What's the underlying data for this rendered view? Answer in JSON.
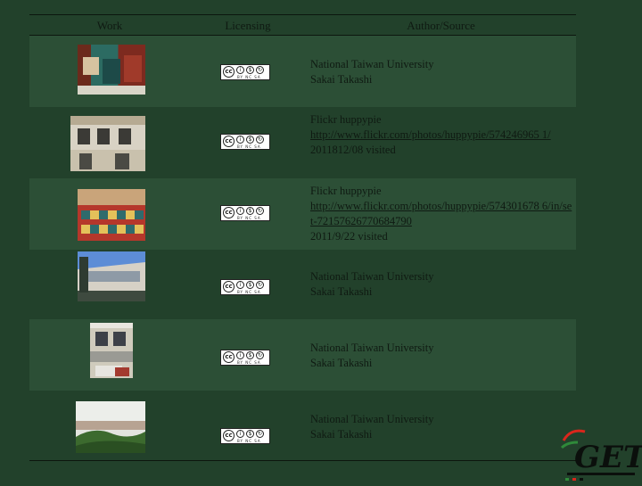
{
  "header": {
    "work": "Work",
    "licensing": "Licensing",
    "author": "Author/Source"
  },
  "license": {
    "badge_text": "BY NC SA",
    "icon": "cc-by-nc-sa-icon"
  },
  "rows": [
    {
      "lines": [
        "National Taiwan University",
        "Sakai Takashi"
      ]
    },
    {
      "lines": [
        "Flickr huppypie"
      ],
      "link": "http://www.flickr.com/photos/huppypie/574246965 1/",
      "after": "2011812/08 visited"
    },
    {
      "lines": [
        "Flickr  huppypie"
      ],
      "link": "http://www.flickr.com/photos/huppypie/574301678 6/in/set-72157626770684790",
      "after": "2011/9/22 visited"
    },
    {
      "lines": [
        "National Taiwan University",
        "Sakai Takashi"
      ]
    },
    {
      "lines": [
        "National Taiwan University",
        "Sakai Takashi"
      ]
    },
    {
      "lines": [
        "National Taiwan University",
        "Sakai Takashi"
      ]
    }
  ],
  "logo": {
    "text": "GET"
  },
  "colors": {
    "bg": "#22412b",
    "row_light": "#2c4f36",
    "text": "#0f1a12",
    "logo_red": "#d9261c",
    "logo_green": "#2f8a3a"
  }
}
